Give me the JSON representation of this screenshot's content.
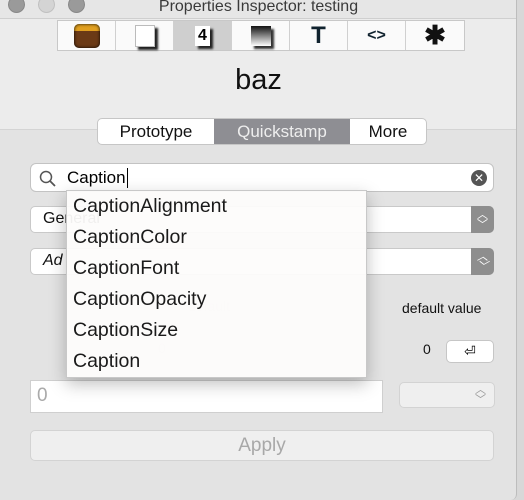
{
  "window": {
    "title": "Properties Inspector: testing"
  },
  "toolbar": {
    "items": [
      {
        "name": "object-icon",
        "selected": false
      },
      {
        "name": "card-icon",
        "selected": false
      },
      {
        "name": "number-icon",
        "label": "4",
        "selected": true
      },
      {
        "name": "gradient-icon",
        "selected": false
      },
      {
        "name": "text-icon",
        "label": "T",
        "selected": false
      },
      {
        "name": "code-icon",
        "label": "<>",
        "selected": false
      },
      {
        "name": "gear-icon",
        "label": "✱",
        "selected": false
      }
    ]
  },
  "object_name": "baz",
  "tabs": [
    {
      "label": "Prototype",
      "selected": false
    },
    {
      "label": "Quickstamp",
      "selected": true
    },
    {
      "label": "More",
      "selected": false
    }
  ],
  "search": {
    "value": "Caption"
  },
  "suggestions": [
    "CaptionAlignment",
    "CaptionColor",
    "CaptionFont",
    "CaptionOpacity",
    "CaptionSize",
    "Caption"
  ],
  "category_popup": {
    "value": "General"
  },
  "property_popup": {
    "value": "Ad"
  },
  "column_labels": {
    "default": "default",
    "default_value": "default value"
  },
  "default_value": {
    "value": "0",
    "ghost_value": "0",
    "return_symbol": "⏎"
  },
  "value_field": {
    "placeholder": "0"
  },
  "apply_button": {
    "label": "Apply",
    "enabled": false
  }
}
